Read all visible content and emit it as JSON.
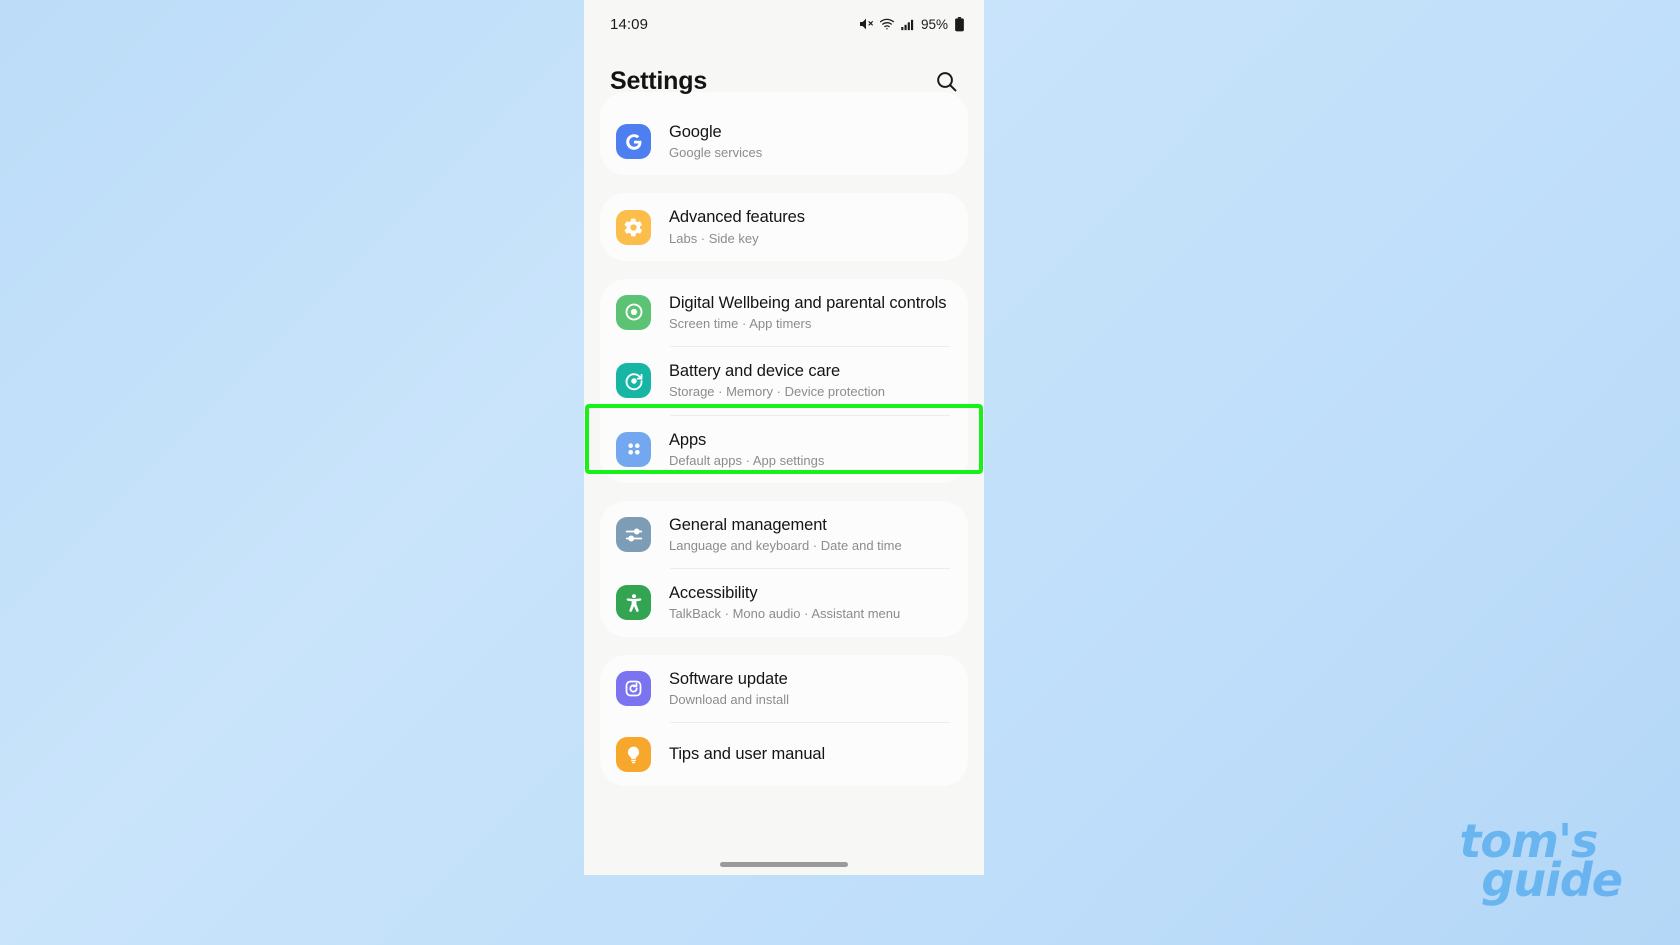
{
  "statusbar": {
    "time": "14:09",
    "battery_percent": "95%",
    "icons": [
      "mute-icon",
      "wifi-icon",
      "signal-icon",
      "battery-icon"
    ]
  },
  "header": {
    "title": "Settings",
    "search_icon": "search-icon"
  },
  "highlight": {
    "target": "Battery and device care",
    "color": "#18f019"
  },
  "watermark": {
    "line1": "tom's",
    "line2": "guide"
  },
  "groups": [
    {
      "id": "google",
      "rows": [
        {
          "title": "Google",
          "subtitle": "Google services",
          "icon": "google-icon",
          "icon_bg": "#4d7ff0",
          "highlighted": false
        }
      ]
    },
    {
      "id": "advanced",
      "rows": [
        {
          "title": "Advanced features",
          "subtitle": "Labs  ·  Side key",
          "icon": "gear-plus-icon",
          "icon_bg": "#fbbe4a",
          "highlighted": false
        }
      ]
    },
    {
      "id": "wellbeing-battery-apps",
      "rows": [
        {
          "title": "Digital Wellbeing and parental controls",
          "subtitle": "Screen time  ·  App timers",
          "icon": "wellbeing-icon",
          "icon_bg": "#5cc274",
          "highlighted": false
        },
        {
          "title": "Battery and device care",
          "subtitle": "Storage  ·  Memory  ·  Device protection",
          "icon": "device-care-icon",
          "icon_bg": "#17b6a4",
          "highlighted": true
        },
        {
          "title": "Apps",
          "subtitle": "Default apps  ·  App settings",
          "icon": "apps-icon",
          "icon_bg": "#73a7ef",
          "highlighted": false
        }
      ]
    },
    {
      "id": "general-accessibility",
      "rows": [
        {
          "title": "General management",
          "subtitle": "Language and keyboard  ·  Date and time",
          "icon": "sliders-icon",
          "icon_bg": "#7d9cb6",
          "highlighted": false
        },
        {
          "title": "Accessibility",
          "subtitle": "TalkBack  ·  Mono audio  ·  Assistant menu",
          "icon": "accessibility-icon",
          "icon_bg": "#33a552",
          "highlighted": false
        }
      ]
    },
    {
      "id": "update-tips",
      "rows": [
        {
          "title": "Software update",
          "subtitle": "Download and install",
          "icon": "refresh-icon",
          "icon_bg": "#7b73f0",
          "highlighted": false
        },
        {
          "title": "Tips and user manual",
          "subtitle": "",
          "icon": "tips-icon",
          "icon_bg": "#f6a72c",
          "highlighted": false
        }
      ]
    }
  ]
}
